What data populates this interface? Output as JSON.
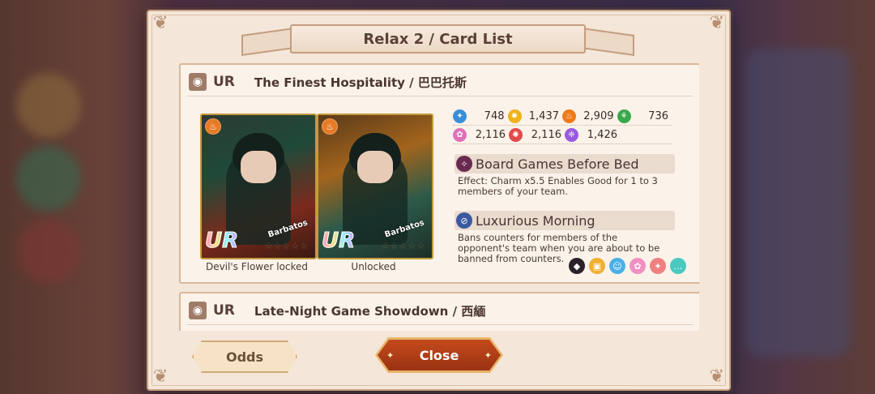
{
  "window": {
    "title": "Relax 2 / Card List"
  },
  "cards": [
    {
      "rarity": "UR",
      "name": "The Finest Hospitality / 巴巴托斯",
      "arts": [
        {
          "caption": "Devil's Flower locked",
          "character": "Barbatos",
          "badge": "UR",
          "stars": "☆☆☆☆☆"
        },
        {
          "caption": "Unlocked",
          "character": "Barbatos",
          "badge": "UR",
          "stars": "☆☆☆☆☆"
        }
      ],
      "stats": [
        {
          "icon": "pride-icon",
          "color": "#3a8fd8",
          "value": "748"
        },
        {
          "icon": "greed-icon",
          "color": "#f0b21a",
          "value": "1,437"
        },
        {
          "icon": "wrath-icon",
          "color": "#f07a1a",
          "value": "2,909"
        },
        {
          "icon": "envy-icon",
          "color": "#3aa84a",
          "value": "736"
        },
        {
          "icon": "lust-icon",
          "color": "#e070b8",
          "value": "2,116"
        },
        {
          "icon": "gluttony-icon",
          "color": "#e24a4a",
          "value": "2,116"
        },
        {
          "icon": "sloth-icon",
          "color": "#9a5ae0",
          "value": "1,426"
        }
      ],
      "skills": [
        {
          "name": "Board Games Before Bed",
          "description": "Effect: Charm x5.5 Enables Good for 1 to 3 members of your team."
        },
        {
          "name": "Luxurious Morning",
          "description": "Bans counters for members of the opponent's team when you are about to be banned from counters."
        }
      ],
      "character_icons": [
        {
          "name": "demon-icon",
          "color": "#2a2228",
          "glyph": "◆"
        },
        {
          "name": "gift-icon",
          "color": "#f0b030",
          "glyph": "▣"
        },
        {
          "name": "face-icon",
          "color": "#4ab0e8",
          "glyph": "☺"
        },
        {
          "name": "plant-icon",
          "color": "#f090c0",
          "glyph": "✿"
        },
        {
          "name": "wand-icon",
          "color": "#f08080",
          "glyph": "✦"
        },
        {
          "name": "chat-icon",
          "color": "#4ac8c0",
          "glyph": "…"
        }
      ]
    },
    {
      "rarity": "UR",
      "name": "Late-Night Game Showdown / 西緬"
    }
  ],
  "buttons": {
    "odds": "Odds",
    "close": "Close"
  },
  "colors": {
    "panel_bg": "#f4e6d9",
    "close_button": "#b43e18",
    "odds_button": "#f6e3c6"
  }
}
